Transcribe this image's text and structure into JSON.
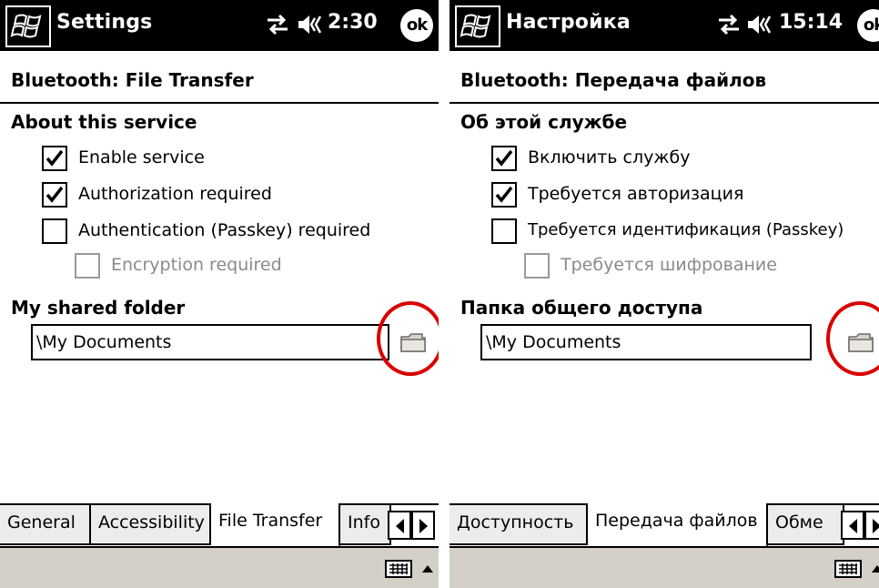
{
  "left": {
    "title": "Settings",
    "clock": "2:30",
    "ok": "ok",
    "page_header": "Bluetooth: File Transfer",
    "about_title": "About this service",
    "checkboxes": [
      {
        "label": "Enable service",
        "checked": true,
        "enabled": true
      },
      {
        "label": "Authorization required",
        "checked": true,
        "enabled": true
      },
      {
        "label": "Authentication (Passkey) required",
        "checked": false,
        "enabled": true
      },
      {
        "label": "Encryption required",
        "checked": false,
        "enabled": false
      }
    ],
    "folder_title": "My shared folder",
    "folder_value": "\\My Documents",
    "tabs": [
      "General",
      "Accessibility",
      "File Transfer",
      "Info"
    ],
    "active_tab": "File Transfer"
  },
  "right": {
    "title": "Настройка",
    "clock": "15:14",
    "ok": "ok",
    "page_header": "Bluetooth: Передача файлов",
    "about_title": "Об этой службе",
    "checkboxes": [
      {
        "label": "Включить службу",
        "checked": true,
        "enabled": true
      },
      {
        "label": "Требуется авторизация",
        "checked": true,
        "enabled": true
      },
      {
        "label": "Требуется идентификация (Passkey)",
        "checked": false,
        "enabled": true
      },
      {
        "label": "Требуется шифрование",
        "checked": false,
        "enabled": false
      }
    ],
    "folder_title": "Папка общего доступа",
    "folder_value": "\\My Documents",
    "tabs": [
      "Доступность",
      "Передача файлов",
      "Обме"
    ],
    "active_tab": "Передача файлов"
  },
  "icons": {
    "start": "windows-flag-icon",
    "connectivity": "connectivity-arrows-icon",
    "volume": "speaker-volume-icon",
    "ok": "ok-button-icon",
    "folder": "folder-icon",
    "keyboard": "keyboard-icon",
    "sip_up": "triangle-up-icon",
    "tab_left": "triangle-left-icon",
    "tab_right": "triangle-right-icon"
  },
  "colors": {
    "titlebar": "#000000",
    "highlight_circle": "#d90000",
    "menu_bar": "#d4d0c8",
    "disabled_text": "#8a8a8a"
  }
}
